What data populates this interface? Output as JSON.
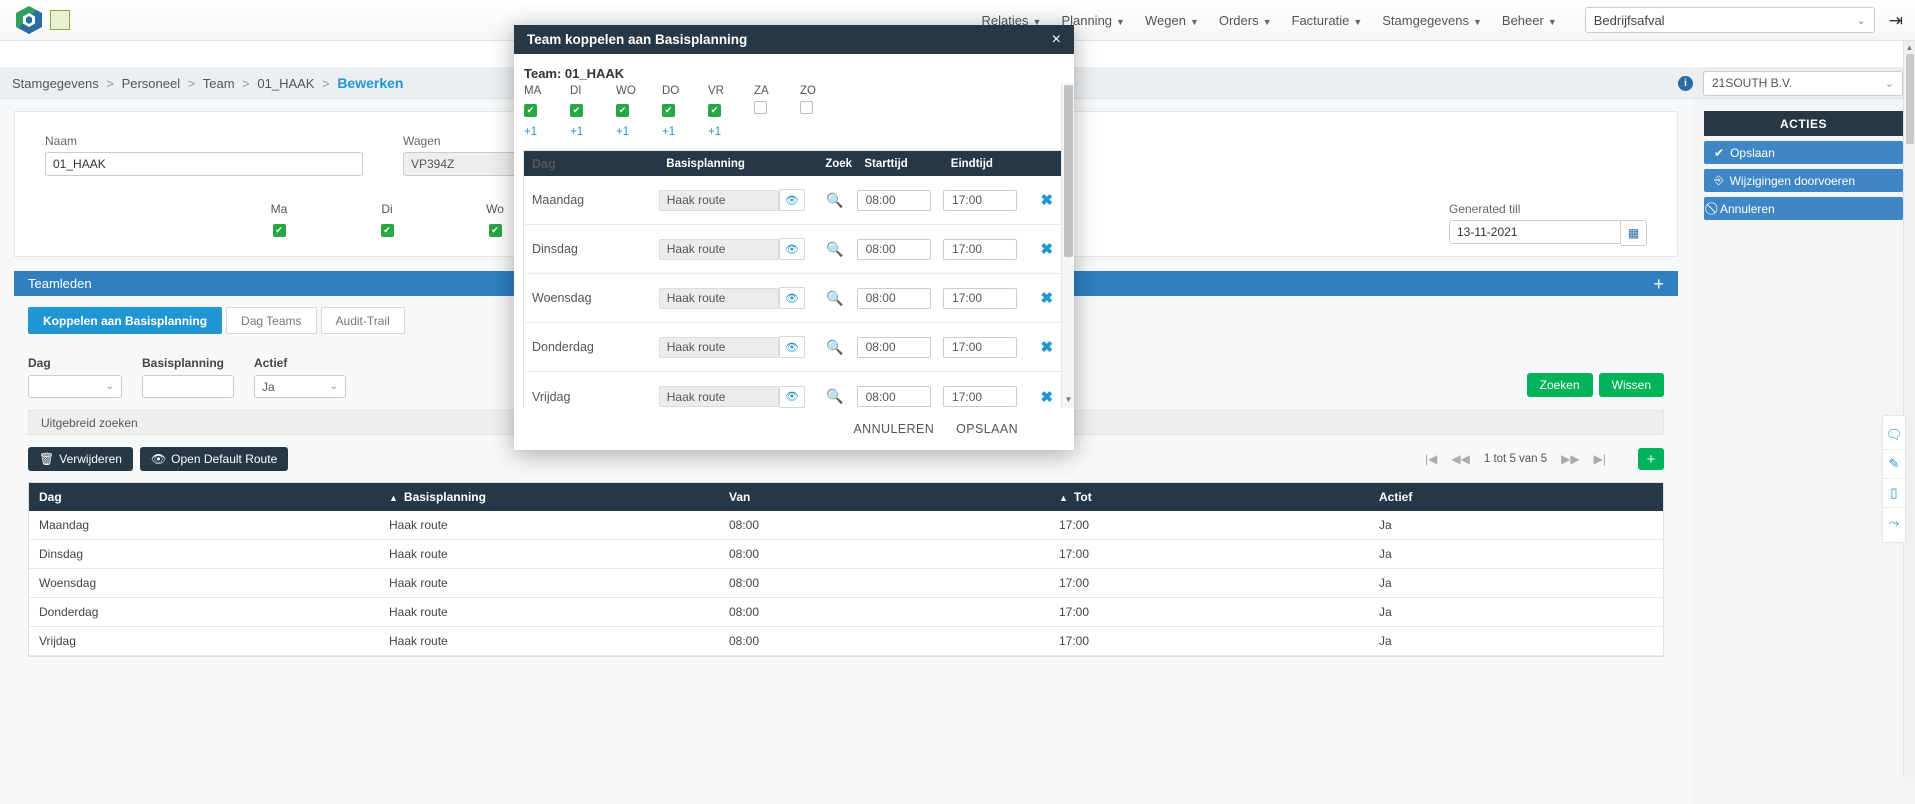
{
  "topbar": {
    "nav": [
      {
        "label": "Relaties"
      },
      {
        "label": "Planning"
      },
      {
        "label": "Wegen"
      },
      {
        "label": "Orders"
      },
      {
        "label": "Facturatie"
      },
      {
        "label": "Stamgegevens"
      },
      {
        "label": "Beheer"
      }
    ],
    "company_value": "Bedrijfsafval"
  },
  "breadcrumb": {
    "items": [
      "Stamgegevens",
      "Personeel",
      "Team",
      "01_HAAK"
    ],
    "current": "Bewerken",
    "tenant_value": "21SOUTH B.V."
  },
  "form": {
    "naam_label": "Naam",
    "naam_value": "01_HAAK",
    "wagen_label": "Wagen",
    "wagen_value": "VP394Z",
    "generated_till_label": "Generated till",
    "generated_till_value": "13-11-2021",
    "days": [
      {
        "label": "Ma",
        "checked": true
      },
      {
        "label": "Di",
        "checked": true
      },
      {
        "label": "Wo",
        "checked": true
      }
    ]
  },
  "panel": {
    "title": "Teamleden",
    "add_label": "+"
  },
  "tabs": [
    {
      "label": "Koppelen aan Basisplanning",
      "active": true
    },
    {
      "label": "Dag Teams",
      "active": false
    },
    {
      "label": "Audit-Trail",
      "active": false
    }
  ],
  "filters": {
    "dag_label": "Dag",
    "dag_value": "",
    "basisplanning_label": "Basisplanning",
    "basisplanning_value": "",
    "actief_label": "Actief",
    "actief_value": "Ja",
    "zoeken_label": "Zoeken",
    "wissen_label": "Wissen",
    "uitgebreid_label": "Uitgebreid zoeken"
  },
  "actions_row": {
    "verwijderen_label": "Verwijderen",
    "open_default_route_label": "Open Default Route",
    "pagination_label": "1 tot 5 van 5",
    "add_label": "+"
  },
  "grid": {
    "columns": [
      "Dag",
      "Basisplanning",
      "Van",
      "Tot",
      "Actief"
    ],
    "rows": [
      {
        "dag": "Maandag",
        "basisplanning": "Haak route",
        "van": "08:00",
        "tot": "17:00",
        "actief": "Ja"
      },
      {
        "dag": "Dinsdag",
        "basisplanning": "Haak route",
        "van": "08:00",
        "tot": "17:00",
        "actief": "Ja"
      },
      {
        "dag": "Woensdag",
        "basisplanning": "Haak route",
        "van": "08:00",
        "tot": "17:00",
        "actief": "Ja"
      },
      {
        "dag": "Donderdag",
        "basisplanning": "Haak route",
        "van": "08:00",
        "tot": "17:00",
        "actief": "Ja"
      },
      {
        "dag": "Vrijdag",
        "basisplanning": "Haak route",
        "van": "08:00",
        "tot": "17:00",
        "actief": "Ja"
      }
    ]
  },
  "sidebar": {
    "header": "ACTIES",
    "buttons": [
      {
        "label": "Opslaan",
        "icon": "check-icon"
      },
      {
        "label": "Wijzigingen doorvoeren",
        "icon": "export-icon"
      },
      {
        "label": "Annuleren",
        "icon": "ban-icon"
      }
    ]
  },
  "toolrail": [
    {
      "icon": "chat-icon"
    },
    {
      "icon": "pencil-icon"
    },
    {
      "icon": "mobile-icon"
    },
    {
      "icon": "share-icon"
    }
  ],
  "modal": {
    "title": "Team koppelen aan Basisplanning",
    "close_label": "×",
    "team_label": "Team: 01_HAAK",
    "days": [
      {
        "label": "MA",
        "checked": true,
        "plus": "+1"
      },
      {
        "label": "DI",
        "checked": true,
        "plus": "+1"
      },
      {
        "label": "WO",
        "checked": true,
        "plus": "+1"
      },
      {
        "label": "DO",
        "checked": true,
        "plus": "+1"
      },
      {
        "label": "VR",
        "checked": true,
        "plus": "+1"
      },
      {
        "label": "ZA",
        "checked": false,
        "plus": ""
      },
      {
        "label": "ZO",
        "checked": false,
        "plus": ""
      }
    ],
    "columns": {
      "dag": "Dag",
      "basisplanning": "Basisplanning",
      "zoek": "Zoek",
      "starttijd": "Starttijd",
      "eindtijd": "Eindtijd"
    },
    "rows": [
      {
        "dag": "Maandag",
        "basisplanning": "Haak route",
        "starttijd": "08:00",
        "eindtijd": "17:00"
      },
      {
        "dag": "Dinsdag",
        "basisplanning": "Haak route",
        "starttijd": "08:00",
        "eindtijd": "17:00"
      },
      {
        "dag": "Woensdag",
        "basisplanning": "Haak route",
        "starttijd": "08:00",
        "eindtijd": "17:00"
      },
      {
        "dag": "Donderdag",
        "basisplanning": "Haak route",
        "starttijd": "08:00",
        "eindtijd": "17:00"
      },
      {
        "dag": "Vrijdag",
        "basisplanning": "Haak route",
        "starttijd": "08:00",
        "eindtijd": "17:00"
      }
    ],
    "cancel_label": "ANNULEREN",
    "save_label": "OPSLAAN"
  }
}
